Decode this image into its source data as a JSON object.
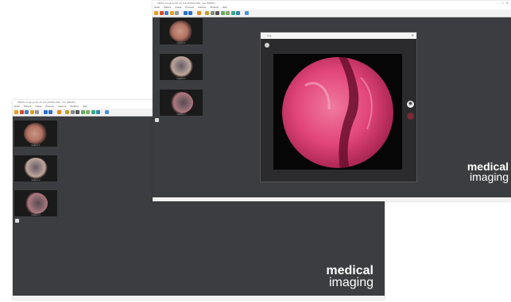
{
  "back_window": {
    "title": "MMPS Imaging DVI 30 Volt [WPRH-006] - bar [BMMP]",
    "menu": [
      "Datei",
      "Patient",
      "Image",
      "Preview",
      "Capture",
      "Window",
      "Help"
    ],
    "thumbnails": [
      {
        "label": "Capture 1"
      },
      {
        "label": "Capture 2"
      },
      {
        "label": "Capture 3"
      }
    ],
    "brand": {
      "line1": "medical",
      "line2": "imaging"
    }
  },
  "front_window": {
    "title": "MMPS Imaging DVI 30 Volt [WPRH-006] - bar [BMMP]",
    "menu": [
      "Datei",
      "Patient",
      "Image",
      "Preview",
      "Capture",
      "Window",
      "Help"
    ],
    "thumbnails": [
      {
        "label": "Capture 1"
      },
      {
        "label": "Capture 2"
      },
      {
        "label": "Capture 3"
      }
    ],
    "brand": {
      "line1": "medical",
      "line2": "imaging"
    },
    "live_view": {
      "title": "Live"
    }
  },
  "colors": {
    "app_bg": "#3c3d40",
    "tissue_pink": "#e2457a",
    "brand_text": "#ffffff"
  },
  "icons": [
    "camera-icon",
    "record-icon",
    "settings-icon",
    "close-icon",
    "help-icon"
  ]
}
